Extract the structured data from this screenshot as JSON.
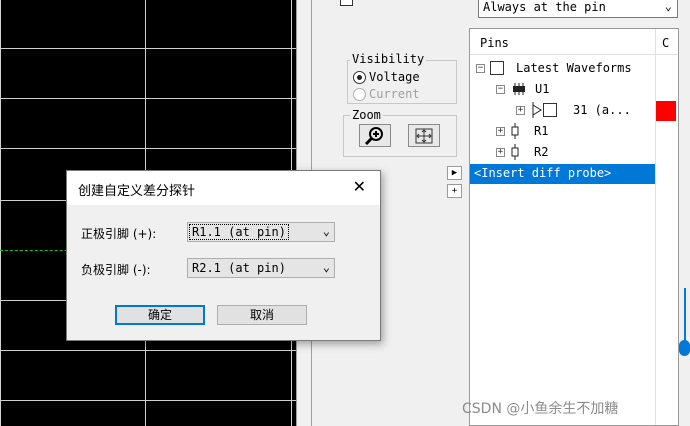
{
  "topbar": {
    "probe_mode": "Always at the pin"
  },
  "visibility": {
    "title": "Visibility",
    "voltage": "Voltage",
    "current": "Current",
    "voltage_selected": true
  },
  "zoom": {
    "title": "Zoom"
  },
  "pins_panel": {
    "col_pins": "Pins",
    "col_c": "C",
    "tree": [
      {
        "label": "Latest Waveforms"
      },
      {
        "label": "U1"
      },
      {
        "label": "31 (a..."
      },
      {
        "label": "R1"
      },
      {
        "label": "R2"
      }
    ],
    "insert_row": "<Insert diff probe>",
    "color_swatch": "#ff0000"
  },
  "dialog": {
    "title": "创建自定义差分探针",
    "positive_label": "正极引脚 (+):",
    "positive_value": "R1.1 (at pin)",
    "negative_label": "负极引脚 (-):",
    "negative_value": "R2.1 (at pin)",
    "ok_label": "确定",
    "cancel_label": "取消"
  },
  "watermark": "CSDN @小鱼余生不加糖"
}
